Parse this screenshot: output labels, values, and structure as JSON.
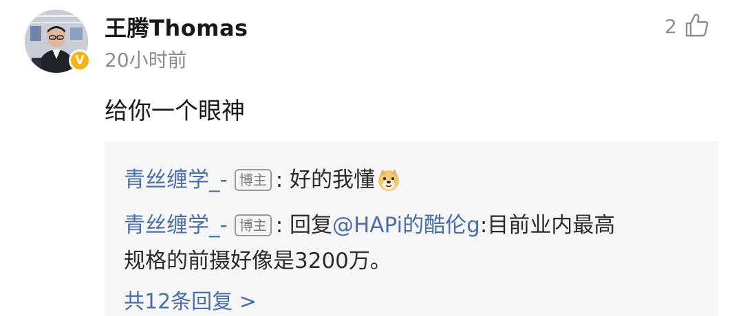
{
  "comment": {
    "username": "王腾Thomas",
    "timestamp": "20小时前",
    "like_count": "2",
    "text": "给你一个眼神",
    "verified_badge": "V",
    "colors": {
      "link": "#4a6ea8",
      "badge": "#f6b40f",
      "muted": "#8c8c8c"
    },
    "icons": {
      "like": "thumbs-up-icon",
      "emoji": "doge-emoji-icon"
    }
  },
  "replies": [
    {
      "author": "青丝缠学_-",
      "tag": "博主",
      "separator": ":",
      "text": "好的我懂"
    },
    {
      "author": "青丝缠学_-",
      "tag": "博主",
      "separator": ":",
      "prefix": "回复",
      "mention": "@HAPi的酷伦g",
      "text_line1": ":目前业内最高",
      "text_line2": "规格的前摄好像是3200万。"
    }
  ],
  "more_replies_label": "共12条回复 >"
}
